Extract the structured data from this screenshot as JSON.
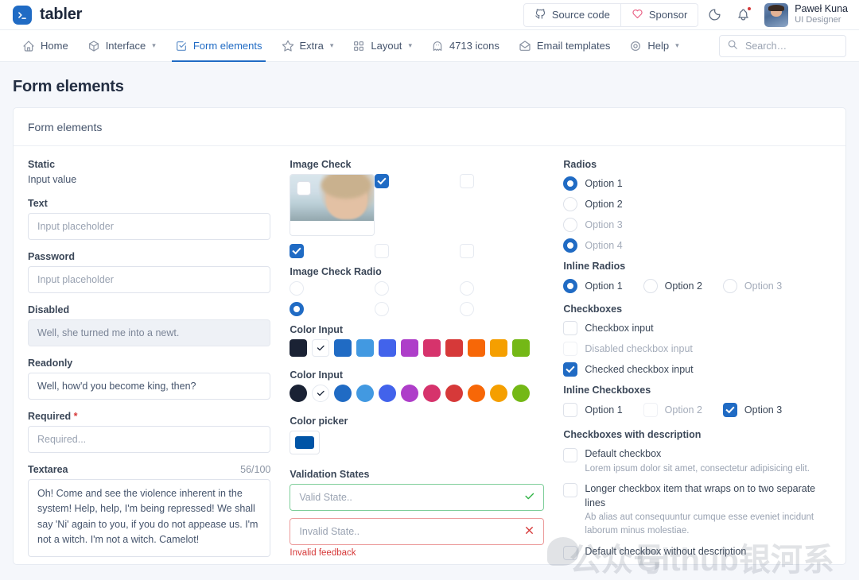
{
  "header": {
    "brand_name": "tabler",
    "brand_icon": "terminal-icon",
    "source_code_label": "Source code",
    "sponsor_label": "Sponsor",
    "theme_toggle_icon": "moon-icon",
    "notifications_icon": "bell-icon",
    "user_name": "Paweł Kuna",
    "user_role": "UI Designer"
  },
  "nav": {
    "items": [
      {
        "label": "Home",
        "icon": "home-icon",
        "caret": false,
        "active": false
      },
      {
        "label": "Interface",
        "icon": "package-icon",
        "caret": true,
        "active": false
      },
      {
        "label": "Form elements",
        "icon": "checkbox-icon",
        "caret": false,
        "active": true
      },
      {
        "label": "Extra",
        "icon": "star-icon",
        "caret": true,
        "active": false
      },
      {
        "label": "Layout",
        "icon": "layout-grid-icon",
        "caret": true,
        "active": false
      },
      {
        "label": "4713 icons",
        "icon": "ghost-icon",
        "caret": false,
        "active": false
      },
      {
        "label": "Email templates",
        "icon": "mail-opened-icon",
        "caret": false,
        "active": false
      },
      {
        "label": "Help",
        "icon": "lifebuoy-icon",
        "caret": true,
        "active": false
      }
    ],
    "search_placeholder": "Search…"
  },
  "page": {
    "title": "Form elements",
    "card_title": "Form elements"
  },
  "left": {
    "static_label": "Static",
    "static_value": "Input value",
    "text_label": "Text",
    "text_placeholder": "Input placeholder",
    "password_label": "Password",
    "password_placeholder": "Input placeholder",
    "disabled_label": "Disabled",
    "disabled_value": "Well, she turned me into a newt.",
    "readonly_label": "Readonly",
    "readonly_value": "Well, how'd you become king, then?",
    "required_label": "Required",
    "required_star": "*",
    "required_placeholder": "Required...",
    "textarea_label": "Textarea",
    "textarea_count": "56/100",
    "textarea_value": "Oh! Come and see the violence inherent in the system! Help, help, I'm being repressed! We shall say 'Ni' again to you, if you do not appease us. I'm not a witch. I'm not a witch. Camelot!"
  },
  "middle": {
    "image_check_label": "Image Check",
    "image_check_radio_label": "Image Check Radio",
    "color_input_label_1": "Color Input",
    "color_input_label_2": "Color Input",
    "color_picker_label": "Color picker",
    "color_picker_value": "#0054a6",
    "validation_label": "Validation States",
    "valid_placeholder": "Valid State..",
    "invalid_placeholder": "Invalid State..",
    "invalid_feedback": "Invalid feedback",
    "swatches": [
      "#1a2234",
      "selected",
      "#206bc4",
      "#4299e1",
      "#4263eb",
      "#ae3ec9",
      "#d6336c",
      "#d63939",
      "#f76707",
      "#f59f00",
      "#74b816"
    ],
    "image_check_states": [
      [
        "photo-checked",
        "checked",
        "unchecked"
      ],
      [
        "checked",
        "unchecked",
        "unchecked"
      ]
    ],
    "image_radio_states": [
      [
        "unchecked",
        "unchecked",
        "unchecked"
      ],
      [
        "checked",
        "unchecked",
        "unchecked"
      ]
    ]
  },
  "right": {
    "radios_label": "Radios",
    "radios": [
      {
        "label": "Option 1",
        "checked": true,
        "disabled": false
      },
      {
        "label": "Option 2",
        "checked": false,
        "disabled": false
      },
      {
        "label": "Option 3",
        "checked": false,
        "disabled": true
      },
      {
        "label": "Option 4",
        "checked": true,
        "disabled": true
      }
    ],
    "inline_radios_label": "Inline Radios",
    "inline_radios": [
      {
        "label": "Option 1",
        "checked": true,
        "disabled": false
      },
      {
        "label": "Option 2",
        "checked": false,
        "disabled": false
      },
      {
        "label": "Option 3",
        "checked": false,
        "disabled": true
      }
    ],
    "checkboxes_label": "Checkboxes",
    "checkboxes": [
      {
        "label": "Checkbox input",
        "checked": false,
        "disabled": false
      },
      {
        "label": "Disabled checkbox input",
        "checked": false,
        "disabled": true
      },
      {
        "label": "Checked checkbox input",
        "checked": true,
        "disabled": false
      }
    ],
    "inline_checkboxes_label": "Inline Checkboxes",
    "inline_checkboxes": [
      {
        "label": "Option 1",
        "checked": false,
        "disabled": false
      },
      {
        "label": "Option 2",
        "checked": false,
        "disabled": true
      },
      {
        "label": "Option 3",
        "checked": true,
        "disabled": false
      }
    ],
    "desc_label": "Checkboxes with description",
    "desc_items": [
      {
        "title": "Default checkbox",
        "desc": "Lorem ipsum dolor sit amet, consectetur adipisicing elit.",
        "checked": false
      },
      {
        "title": "Longer checkbox item that wraps on to two separate lines",
        "desc": "Ab alias aut consequuntur cumque esse eveniet incidunt laborum minus molestiae.",
        "checked": false
      },
      {
        "title": "Default checkbox without description",
        "desc": "",
        "checked": false
      }
    ]
  },
  "watermark": {
    "text_cn": "公众号",
    "text_en": "Github银河系"
  },
  "colors": {
    "primary": "#206bc4",
    "danger": "#d63939",
    "success": "#2fb344",
    "page_bg": "#f5f7fb"
  }
}
